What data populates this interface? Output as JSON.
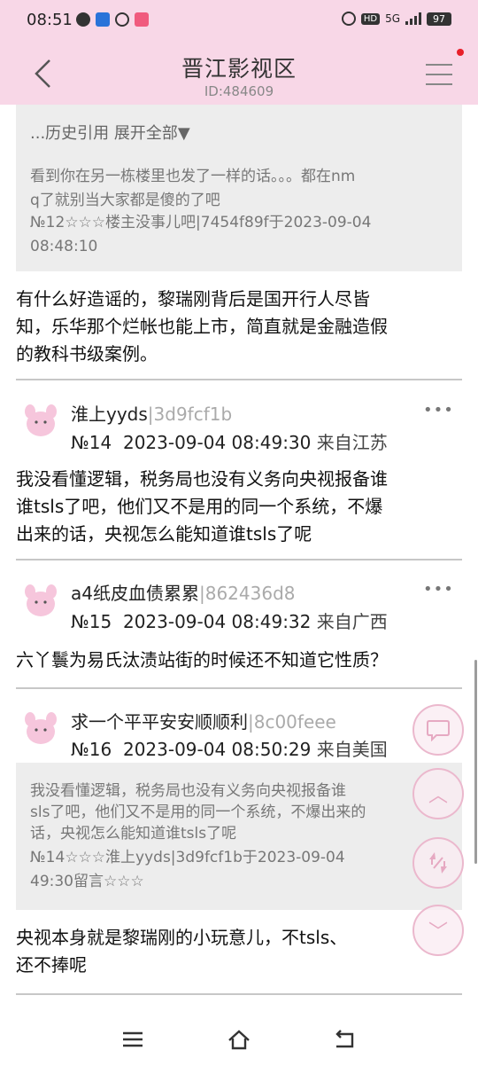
{
  "status": {
    "time": "08:51",
    "net": "5G",
    "battery": "97",
    "hd": "HD"
  },
  "header": {
    "title": "晋江影视区",
    "id_label": "ID:484609"
  },
  "quote1": {
    "history_toggle": "...历史引用 展开全部▼",
    "line1": "看到你在另一栋楼里也发了一样的话。。。都在nm",
    "line2": "q了就别当大家都是傻的了吧",
    "meta1": "№12☆☆☆楼主没事儿吧|7454f89f于2023-09-04",
    "meta2": "08:48:10"
  },
  "post13_text": {
    "l1": "有什么好造谣的，黎瑞刚背后是国开行人尽皆",
    "l2": "知，乐华那个烂帐也能上市，简直就是金融造假",
    "l3": "的教科书级案例。"
  },
  "posts": [
    {
      "name": "淮上yyds",
      "hash": "|3d9fcf1b",
      "floor": "№14",
      "datetime": "2023-09-04 08:49:30",
      "location": "来自江苏",
      "text": {
        "l1": "我没看懂逻辑，税务局也没有义务向央视报备谁",
        "l2": "谁tsls了吧，他们又不是用的同一个系统，不爆",
        "l3": "出来的话，央视怎么能知道谁tsls了呢"
      }
    },
    {
      "name": "a4纸皮血债累累",
      "hash": "|862436d8",
      "floor": "№15",
      "datetime": "2023-09-04 08:49:32",
      "location": "来自广西",
      "text": {
        "l1": "六丫鬟为易氏汰渍站街的时候还不知道它性质？"
      }
    },
    {
      "name": "求一个平平安安顺顺利",
      "hash": "|8c00feee",
      "floor": "№16",
      "datetime": "2023-09-04 08:50:29",
      "location": "来自美国",
      "quote": {
        "l1": "我没看懂逻辑，税务局也没有义务向央视报备谁",
        "l2": "sls了吧，他们又不是用的同一个系统，不爆出来的",
        "l3": "话，央视怎么能知道谁tsls了呢",
        "m1": "№14☆☆☆淮上yyds|3d9fcf1b于2023-09-04",
        "m2": "49:30留言☆☆☆"
      },
      "text": {
        "l1": "央视本身就是黎瑞刚的小玩意儿，不tsls、",
        "l2": "还不捧呢"
      }
    }
  ],
  "more_label": "•••",
  "fab": {
    "top_label": "︿",
    "bottom_label": "﹀"
  },
  "colors": {
    "header_bg": "#f8d7e7",
    "quote_bg": "#ededed",
    "fab_border": "#ebb8cd"
  }
}
